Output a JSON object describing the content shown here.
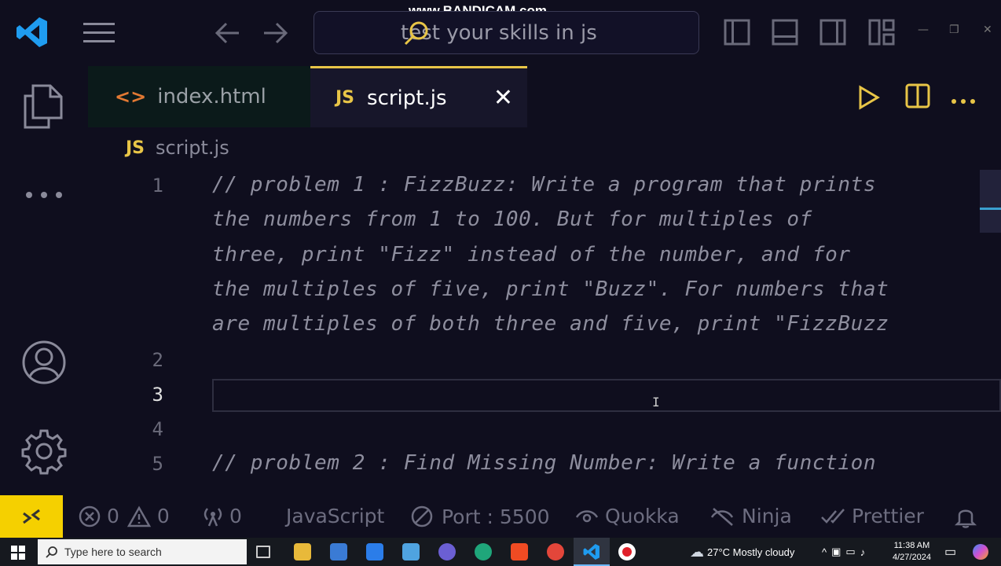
{
  "watermark": "www.BANDICAM.com",
  "titlebar": {
    "search_text": "test your skills in js"
  },
  "tabs": [
    {
      "label": "index.html",
      "badge": "<>"
    },
    {
      "label": "script.js",
      "badge": "JS"
    }
  ],
  "breadcrumb": {
    "badge": "JS",
    "file": "script.js"
  },
  "editor": {
    "line_numbers": [
      "1",
      "2",
      "3",
      "4",
      "5"
    ],
    "wrapped_lines": [
      "// problem 1 : FizzBuzz: Write a program that prints",
      "the numbers from 1 to 100. But for multiples of",
      "three, print \"Fizz\" instead of the number, and for",
      "the multiples of five, print \"Buzz\". For numbers that",
      "are multiples of both three and five, print \"FizzBuzz",
      "// problem 2 : Find Missing Number: Write a function"
    ],
    "current_line": "3"
  },
  "statusbar": {
    "errors": "0",
    "warnings": "0",
    "ports": "0",
    "language": "JavaScript",
    "port": "Port : 5500",
    "quokka": "Quokka",
    "ninja": "Ninja",
    "prettier": "Prettier"
  },
  "taskbar": {
    "search_placeholder": "Type here to search",
    "weather": "27°C  Mostly cloudy",
    "time": "11:38 AM",
    "date": "4/27/2024"
  },
  "colors": {
    "accent": "#e8c547",
    "js": "#e8c547",
    "remote": "#f5d000",
    "vscode": "#1f9cf0"
  }
}
